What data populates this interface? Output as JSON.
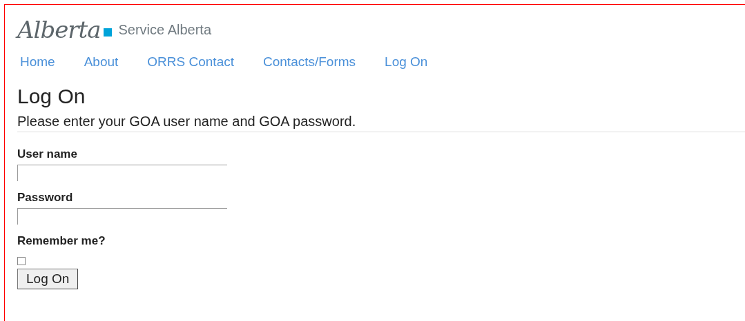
{
  "header": {
    "logo": "Alberta",
    "ministry": "Service Alberta"
  },
  "nav": [
    {
      "label": "Home"
    },
    {
      "label": "About"
    },
    {
      "label": "ORRS Contact"
    },
    {
      "label": "Contacts/Forms"
    },
    {
      "label": "Log On"
    }
  ],
  "heading": "Log On",
  "instructions": "Please enter your GOA user name and GOA password.",
  "form": {
    "fields": [
      {
        "kind": "text",
        "label": "User name"
      },
      {
        "kind": "password",
        "label": "Password"
      },
      {
        "kind": "checkbox",
        "label": "Remember me?",
        "checked": false
      }
    ],
    "submit": "Log On"
  }
}
